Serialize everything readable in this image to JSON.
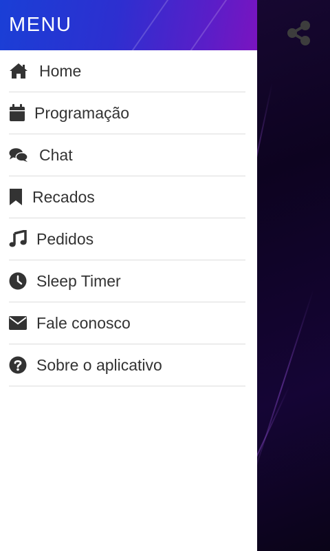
{
  "drawer": {
    "title": "MENU",
    "items": [
      {
        "label": "Home",
        "icon": "home-icon"
      },
      {
        "label": "Programação",
        "icon": "calendar-icon"
      },
      {
        "label": "Chat",
        "icon": "chat-icon"
      },
      {
        "label": "Recados",
        "icon": "bookmark-icon"
      },
      {
        "label": "Pedidos",
        "icon": "music-icon"
      },
      {
        "label": "Sleep Timer",
        "icon": "clock-icon"
      },
      {
        "label": "Fale conosco",
        "icon": "envelope-icon"
      },
      {
        "label": "Sobre o aplicativo",
        "icon": "question-icon"
      }
    ]
  },
  "colors": {
    "header_start": "#1a3fd6",
    "header_end": "#7a14c0",
    "text": "#333333",
    "divider": "#dcdcdc",
    "share_icon": "#3d3d3d"
  },
  "share": {
    "icon": "share-icon"
  }
}
